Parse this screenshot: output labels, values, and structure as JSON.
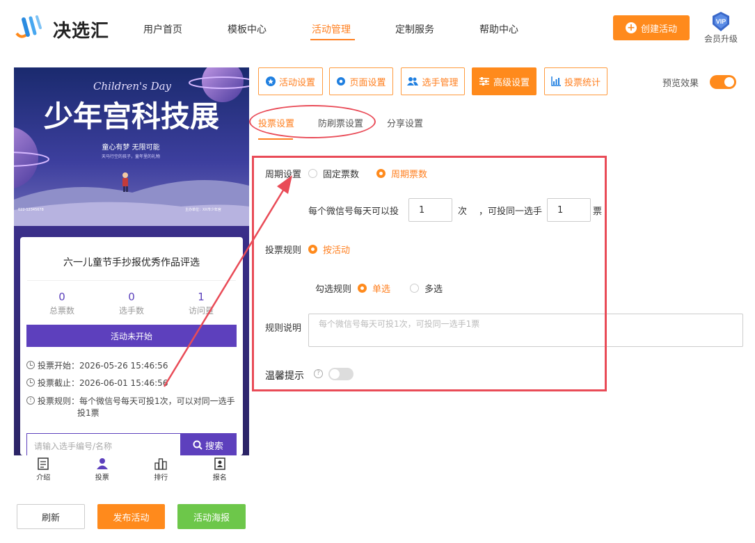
{
  "brand": {
    "name": "决选汇"
  },
  "nav": {
    "items": [
      "用户首页",
      "模板中心",
      "活动管理",
      "定制服务",
      "帮助中心"
    ],
    "active": "活动管理"
  },
  "header": {
    "create_label": "创建活动",
    "vip_badge": "VIP",
    "vip_label": "会员升级"
  },
  "preview": {
    "banner": {
      "script": "Children's Day",
      "title": "少年宫科技展",
      "slogan": "童心有梦 无限可能",
      "sub": "天马行空的孩子，童年里的礼物",
      "footer_left": "022-12345678",
      "footer_right": "主办单位：XX市少年宫"
    },
    "card_title": "六一儿童节手抄报优秀作品评选",
    "stats": [
      {
        "num": "0",
        "label": "总票数"
      },
      {
        "num": "0",
        "label": "选手数"
      },
      {
        "num": "1",
        "label": "访问量"
      }
    ],
    "status": "活动未开始",
    "vote_start": "投票开始：2026-05-26 15:46:56",
    "vote_end": "投票截止：2026-06-01 15:46:56",
    "rule_line1": "投票规则：每个微信号每天可投1次，可以对同一选手",
    "rule_line2": "投1票",
    "search_placeholder": "请输入选手编号/名称",
    "search_button": "搜索",
    "tabs": [
      "介绍",
      "投票",
      "排行",
      "报名"
    ]
  },
  "actions": {
    "refresh": "刷新",
    "publish": "发布活动",
    "poster": "活动海报"
  },
  "settings_tabs": [
    "活动设置",
    "页面设置",
    "选手管理",
    "高级设置",
    "投票统计"
  ],
  "active_settings_tab": "高级设置",
  "preview_toggle": {
    "label": "预览效果",
    "on": true
  },
  "subtabs": [
    "投票设置",
    "防刷票设置",
    "分享设置"
  ],
  "form": {
    "cycle_label": "周期设置",
    "cycle_options": [
      "固定票数",
      "周期票数"
    ],
    "cycle_selected": "周期票数",
    "per_day_text": "每个微信号每天可以投",
    "per_day_value": "1",
    "per_day_unit": "次",
    "same_text": "，可投同一选手",
    "same_value": "1",
    "same_unit": "票",
    "rule_label": "投票规则",
    "rule_option": "按活动",
    "select_label": "勾选规则",
    "select_options": [
      "单选",
      "多选"
    ],
    "select_selected": "单选",
    "desc_label": "规则说明",
    "desc_placeholder": "每个微信号每天可投1次，可投同一选手1票",
    "tip_label": "温馨提示",
    "tip_on": false
  },
  "colors": {
    "accent": "#ff8a1c",
    "purple": "#5d40bd",
    "green": "#6dc74a",
    "annotation": "#e94b57"
  }
}
